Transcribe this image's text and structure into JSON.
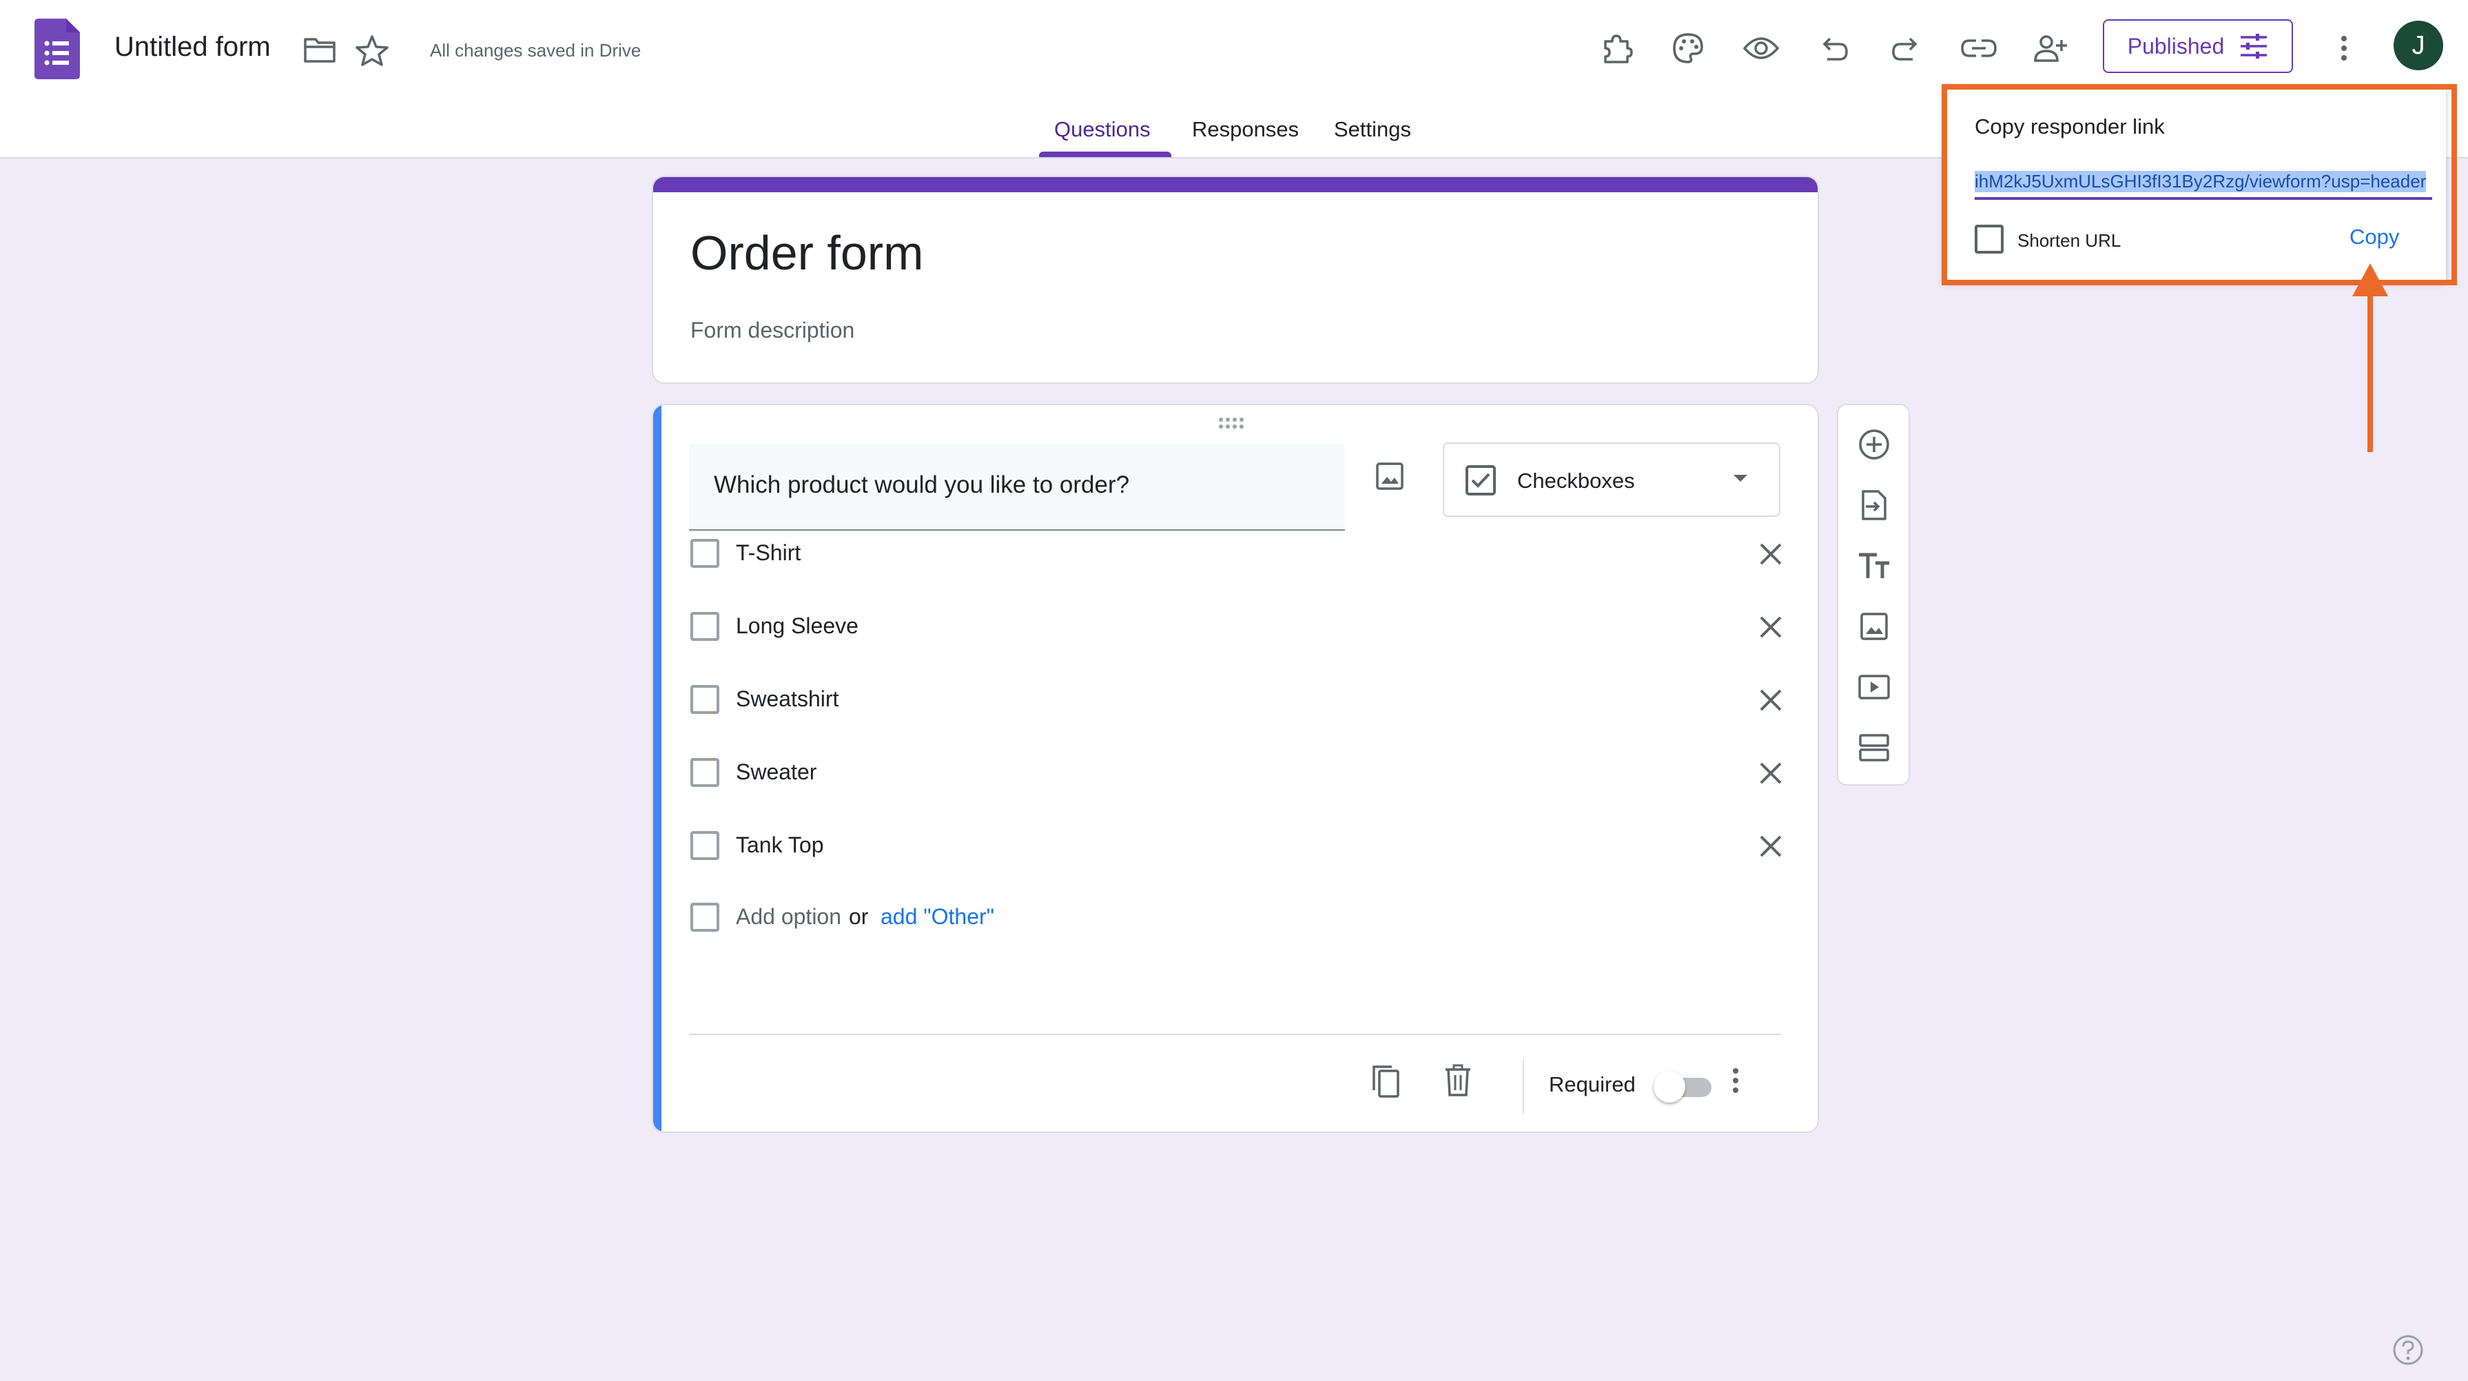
{
  "header": {
    "doc_title": "Untitled form",
    "save_status": "All changes saved in Drive",
    "publish_label": "Published",
    "avatar_letter": "J"
  },
  "tabs": [
    {
      "label": "Questions",
      "active": true
    },
    {
      "label": "Responses",
      "active": false
    },
    {
      "label": "Settings",
      "active": false
    }
  ],
  "form": {
    "title": "Order form",
    "description_placeholder": "Form description"
  },
  "question": {
    "text": "Which product would you like to order?",
    "type": "Checkboxes",
    "options": [
      "T-Shirt",
      "Long Sleeve",
      "Sweatshirt",
      "Sweater",
      "Tank Top"
    ],
    "add_option_label": "Add option",
    "or_text": "or",
    "add_other_label": "add \"Other\"",
    "required_label": "Required",
    "required_on": false
  },
  "popup": {
    "title": "Copy responder link",
    "link": "ihM2kJ5UxmULsGHI3fI31By2Rzg/viewform?usp=header",
    "shorten_label": "Shorten URL",
    "copy_label": "Copy"
  },
  "colors": {
    "accent": "#673ab7",
    "callout": "#ea6a2a",
    "link_blue": "#1a73e8",
    "question_bar": "#4285f4",
    "background": "#f0ebf8"
  }
}
